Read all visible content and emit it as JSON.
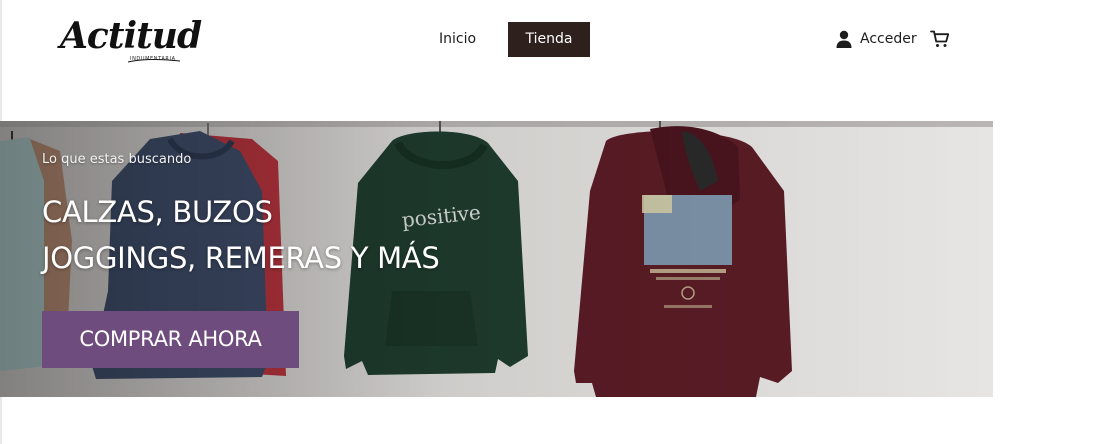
{
  "header": {
    "logo": {
      "text": "Actitud",
      "subtext": "INDUMENTARIA"
    },
    "nav": {
      "items": [
        {
          "label": "Inicio",
          "active": false
        },
        {
          "label": "Tienda",
          "active": true
        }
      ]
    },
    "account": {
      "label": "Acceder",
      "icon": "user-icon"
    },
    "cart": {
      "icon": "cart-icon"
    }
  },
  "hero": {
    "eyebrow": "Lo que estas buscando",
    "heading_line_1": "CALZAS, BUZOS",
    "heading_line_2": "JOGGINGS, REMERAS Y MÁS",
    "cta_label": "COMPRAR AHORA",
    "print_text": "positive"
  },
  "colors": {
    "nav_active_bg": "#2e211d",
    "cta_bg": "#6e4d7e",
    "hero_wall": "#dedcd9"
  }
}
